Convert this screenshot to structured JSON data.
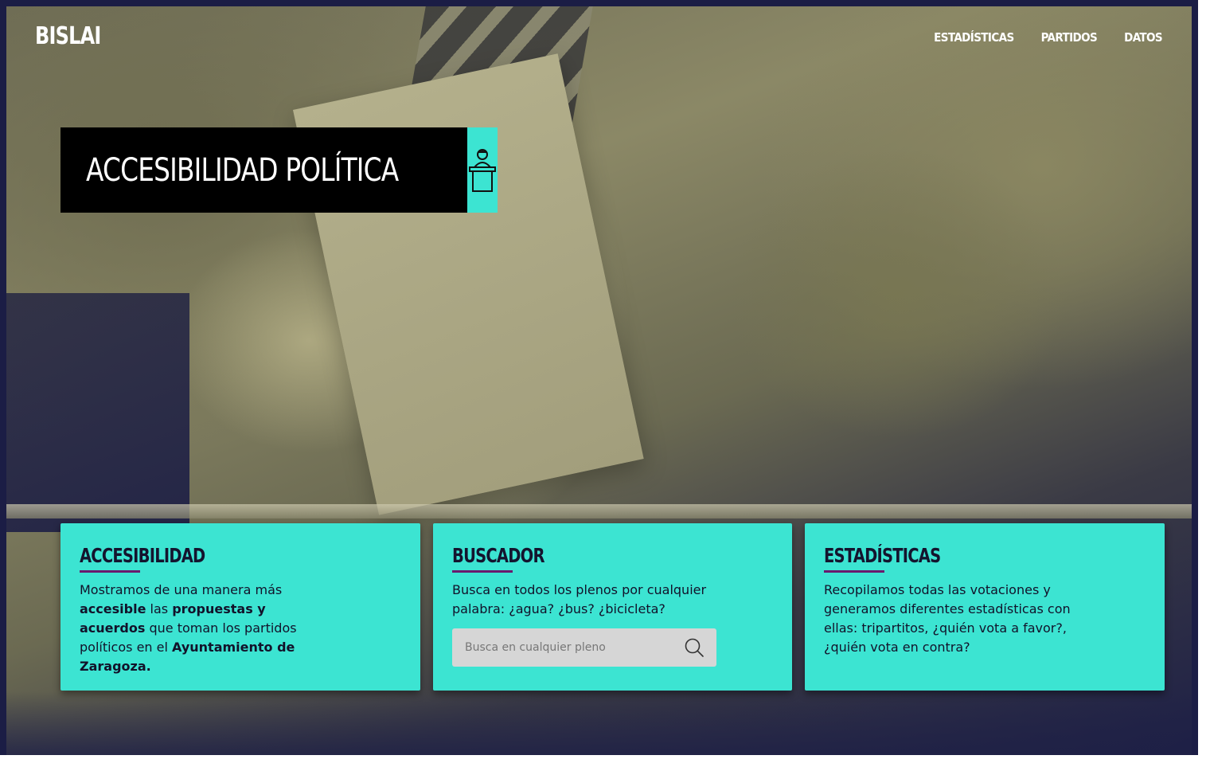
{
  "brand": {
    "logo": "BISLAI"
  },
  "nav": {
    "items": [
      {
        "label": "ESTADÍSTICAS"
      },
      {
        "label": "PARTIDOS"
      },
      {
        "label": "DATOS"
      }
    ]
  },
  "hero": {
    "title": "ACCESIBILIDAD POLÍTICA",
    "title_icon": "speaker-podium-icon"
  },
  "cards": [
    {
      "heading": "ACCESIBILIDAD",
      "text_1": "Mostramos de una manera más ",
      "bold_1": "accesible",
      "text_2": " las ",
      "bold_2": "propuestas y acuerdos",
      "text_3": " que toman los partidos políticos en el ",
      "bold_3": "Ayuntamiento de Zaragoza."
    },
    {
      "heading": "BUSCADOR",
      "text": "Busca en todos los plenos por cualquier palabra: ¿agua? ¿bus? ¿bicicleta?",
      "search_placeholder": "Busca en cualquier pleno",
      "search_icon": "search-icon"
    },
    {
      "heading": "ESTADÍSTICAS",
      "text": "Recopilamos todas las votaciones y generamos diferentes estadísticas con ellas: tripartitos, ¿quién vota a favor?, ¿quién vota en contra?"
    }
  ],
  "colors": {
    "accent": "#3ce4d2",
    "underline": "#6a1a6e",
    "frame": "#1b1d45",
    "title_bg": "#000000"
  }
}
